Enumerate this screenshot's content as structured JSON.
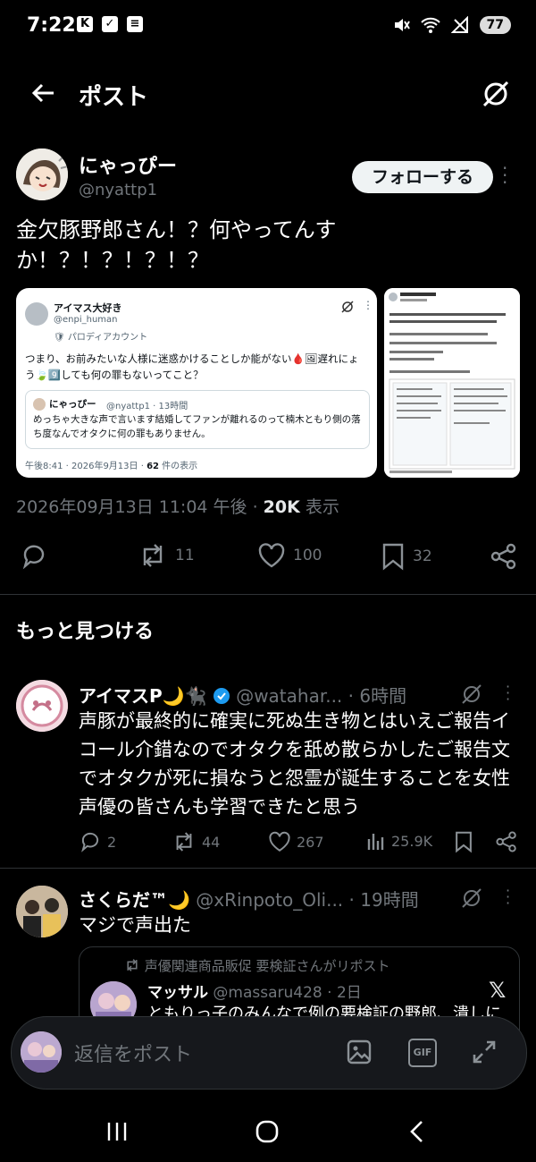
{
  "status_bar": {
    "time": "7:22",
    "battery": "77"
  },
  "header": {
    "title": "ポスト"
  },
  "tweet": {
    "display_name": "にゃっぴー",
    "handle": "@nyattp1",
    "follow_label": "フォローする",
    "text": "金欠豚野郎さん！？何やってんすか！？！？！？！？",
    "meta_time": "2026年09月13日 11:04 午後 · ",
    "meta_views_count": "20K",
    "meta_views_label": " 表示",
    "counts": {
      "replies": "",
      "reposts": "11",
      "likes": "100",
      "bookmarks": "32"
    }
  },
  "embedded_screenshot": {
    "name": "アイマス大好き",
    "handle": "@enpi_human",
    "parody": "パロディアカウント",
    "text": "つまり、お前みたいな人様に迷惑かけることしか能がない🩸🖼遅れにょう🍃9️⃣しても何の罪もないってこと？",
    "quote_name": "にゃっぴー",
    "quote_handle": "@nyattp1 · 13時間",
    "quote_text": "めっちゃ大きな声で言います結婚してファンが離れるのって楠木ともり側の落ち度なんでオタクに何の罪もありません。",
    "footer_time": "午後8:41 · 2026年9月13日 · ",
    "footer_count": "62",
    "footer_label": " 件の表示"
  },
  "section_title": "もっと見つける",
  "feed": [
    {
      "display_name": "アイマスP🌙🐈‍⬛",
      "handle": "@watahar...",
      "time": "· 6時間",
      "text": "声豚が最終的に確実に死ぬ生き物とはいえご報告イコール介錯なのでオタクを舐め散らかしたご報告文でオタクが死に損なうと怨霊が誕生することを女性声優の皆さんも学習できたと思う",
      "replies": "2",
      "reposts": "44",
      "likes": "267",
      "views": "25.9K"
    },
    {
      "display_name": "さくらだ™🌙",
      "handle": "@xRinpoto_Oli...",
      "time": "· 19時間",
      "text": "マジで声出た",
      "quote_repost_label": "声優関連商品販促 要検証さんがリポスト",
      "quote_name": "マッサル",
      "quote_handle": "@massaru428 · 2日",
      "quote_text": "ともりっ子のみんなで例の要検証の野郎、潰しに"
    }
  ],
  "composer": {
    "placeholder": "返信をポスト"
  },
  "icons": [
    "back-arrow-icon",
    "grok-icon",
    "reply-icon",
    "repost-icon",
    "like-icon",
    "bookmark-icon",
    "share-icon",
    "views-icon",
    "image-icon",
    "gif-icon",
    "expand-icon",
    "x-logo-icon"
  ]
}
